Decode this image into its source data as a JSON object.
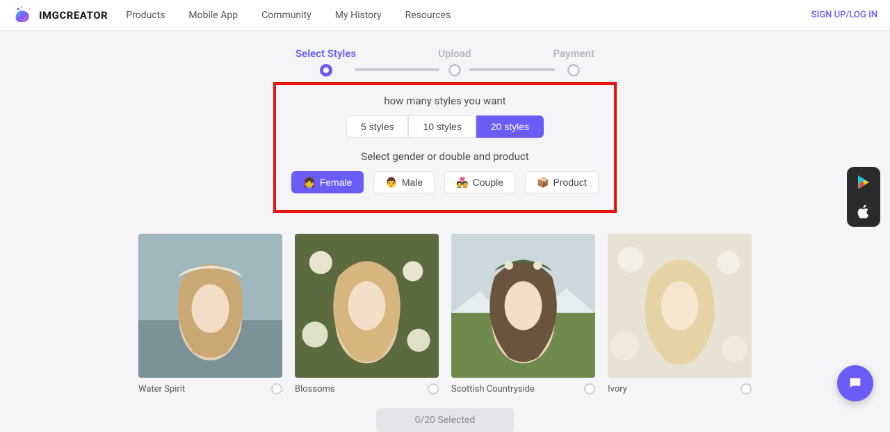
{
  "header": {
    "brand": "IMGCREATOR",
    "nav": [
      "Products",
      "Mobile App",
      "Community",
      "My History",
      "Resources"
    ],
    "auth": "SIGN UP/LOG IN"
  },
  "stepper": {
    "steps": [
      "Select Styles",
      "Upload",
      "Payment"
    ],
    "active_index": 0
  },
  "config": {
    "count_prompt": "how many styles you want",
    "count_options": [
      "5 styles",
      "10 styles",
      "20 styles"
    ],
    "count_selected": "20 styles",
    "gender_prompt": "Select gender or double and product",
    "gender_options": [
      {
        "emoji": "👧",
        "label": "Female",
        "active": true
      },
      {
        "emoji": "👨",
        "label": "Male",
        "active": false
      },
      {
        "emoji": "💑",
        "label": "Couple",
        "active": false
      },
      {
        "emoji": "📦",
        "label": "Product",
        "active": false
      }
    ]
  },
  "cards": [
    {
      "title": "Water Spirit"
    },
    {
      "title": "Blossoms"
    },
    {
      "title": "Scottish Countryside"
    },
    {
      "title": "Ivory"
    }
  ],
  "selection_pill": "0/20 Selected"
}
